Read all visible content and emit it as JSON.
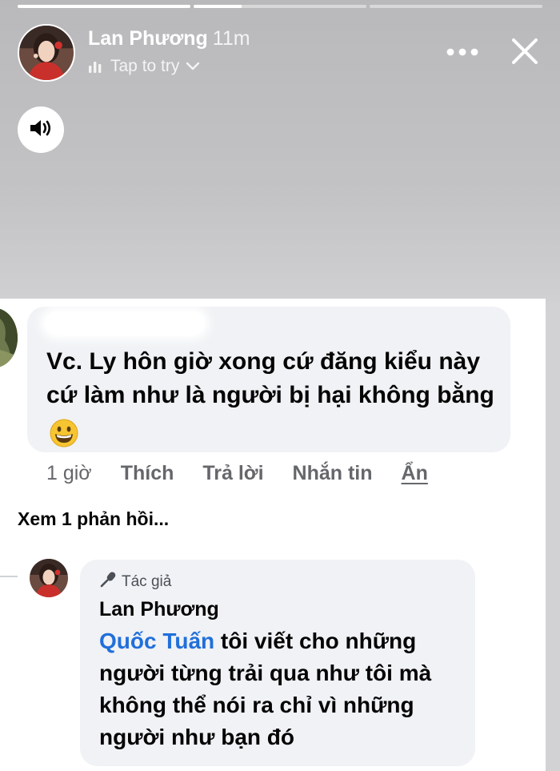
{
  "story": {
    "progress": [
      1,
      0.28,
      0
    ],
    "author_name": "Lan Phương",
    "time_ago": "11m",
    "music_label": "Tap to try",
    "icons": {
      "music": "equalizer-icon",
      "expand": "chevron-down-icon",
      "more": "more-dots-icon",
      "close": "close-icon",
      "sound": "speaker-icon"
    }
  },
  "comment": {
    "text": "Vc. Ly hôn giờ xong cứ đăng kiểu này cứ làm như là người bị hại không bằng",
    "emoji": "grinning-face-emoji",
    "actions": {
      "time": "1 giờ",
      "like": "Thích",
      "reply": "Trả lời",
      "message": "Nhắn tin",
      "hide": "Ẩn"
    },
    "view_replies": "Xem 1 phản hồi..."
  },
  "reply": {
    "badge": "Tác giả",
    "author": "Lan Phương",
    "mention": "Quốc Tuấn",
    "text": " tôi viết cho những người từng trải qua như tôi mà không thể nói ra chỉ vì những người như bạn đó"
  },
  "colors": {
    "mention": "#216fdb",
    "bubble": "#f0f2f5",
    "secondary_text": "#65676b"
  }
}
